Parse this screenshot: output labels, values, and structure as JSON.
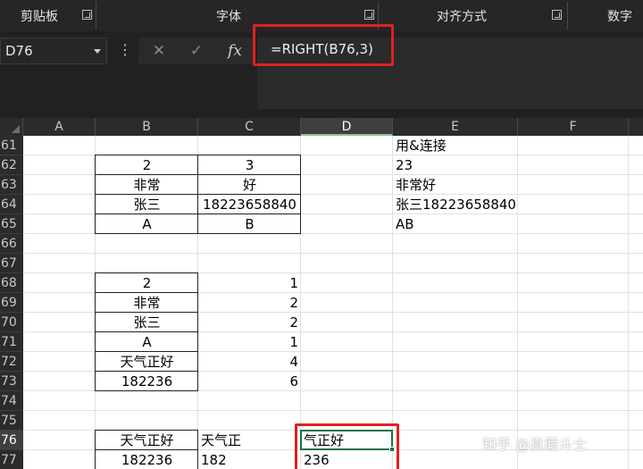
{
  "ribbon": {
    "groups": [
      {
        "label": "剪贴板"
      },
      {
        "label": "字体"
      },
      {
        "label": "对齐方式"
      },
      {
        "label": "数字"
      }
    ]
  },
  "formula_bar": {
    "name_box": "D76",
    "more_glyph": "⋮",
    "cancel_glyph": "✕",
    "enter_glyph": "✓",
    "fx_label": "fx",
    "formula": "=RIGHT(B76,3)"
  },
  "columns": [
    "A",
    "B",
    "C",
    "D",
    "E",
    "F"
  ],
  "active_column": "D",
  "rows": [
    "61",
    "62",
    "63",
    "64",
    "65",
    "66",
    "67",
    "68",
    "69",
    "70",
    "71",
    "72",
    "73",
    "74",
    "75",
    "76",
    "77"
  ],
  "active_row": "76",
  "cells": {
    "E61": "用&连接",
    "B62": "2",
    "C62": "3",
    "E62": "23",
    "B63": "非常",
    "C63": "好",
    "E63": "非常好",
    "B64": "张三",
    "C64": "18223658840",
    "E64": "张三18223658840",
    "B65": "A",
    "C65": "B",
    "E65": "AB",
    "B68": "2",
    "C68": "1",
    "B69": "非常",
    "C69": "2",
    "B70": "张三",
    "C70": "2",
    "B71": "A",
    "C71": "1",
    "B72": "天气正好",
    "C72": "4",
    "B73": "182236",
    "C73": "6",
    "B76": "天气正好",
    "C76": "天气正",
    "D76": "气正好",
    "B77": "182236",
    "C77": "182",
    "D77": "236"
  },
  "colors": {
    "selection": "#1e7145",
    "highlight": "#e02020",
    "ribbon_bg": "#262626"
  },
  "watermark": "知乎 @真假斗士"
}
